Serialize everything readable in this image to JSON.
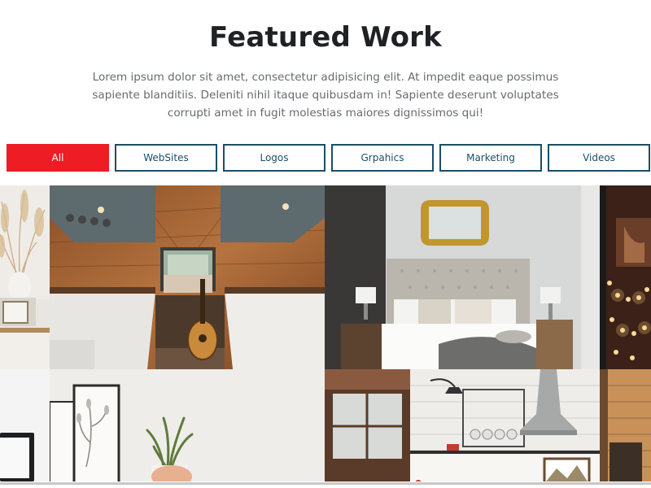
{
  "section": {
    "title": "Featured Work",
    "description": "Lorem ipsum dolor sit amet, consectetur adipisicing elit. At impedit eaque possimus sapiente blanditiis. Deleniti nihil itaque quibusdam in! Sapiente deserunt voluptates corrupti amet in fugit molestias maiores dignissimos qui!"
  },
  "filters": [
    {
      "label": "All",
      "active": true
    },
    {
      "label": "WebSites",
      "active": false
    },
    {
      "label": "Logos",
      "active": false
    },
    {
      "label": "Grpahics",
      "active": false
    },
    {
      "label": "Marketing",
      "active": false
    },
    {
      "label": "Videos",
      "active": false
    }
  ],
  "colors": {
    "accent": "#ee1c25",
    "filter_border": "#1c4e66",
    "title": "#1f2124",
    "description": "#676b70"
  },
  "gallery": {
    "items": [
      {
        "name": "pampas-grass-shelf-image"
      },
      {
        "name": "camper-van-interior-image"
      },
      {
        "name": "bedroom-image"
      },
      {
        "name": "string-lights-room-image"
      },
      {
        "name": "laptop-desk-image"
      },
      {
        "name": "plant-and-frames-image"
      },
      {
        "name": "kitchen-image"
      },
      {
        "name": "wooden-room-image"
      }
    ]
  }
}
